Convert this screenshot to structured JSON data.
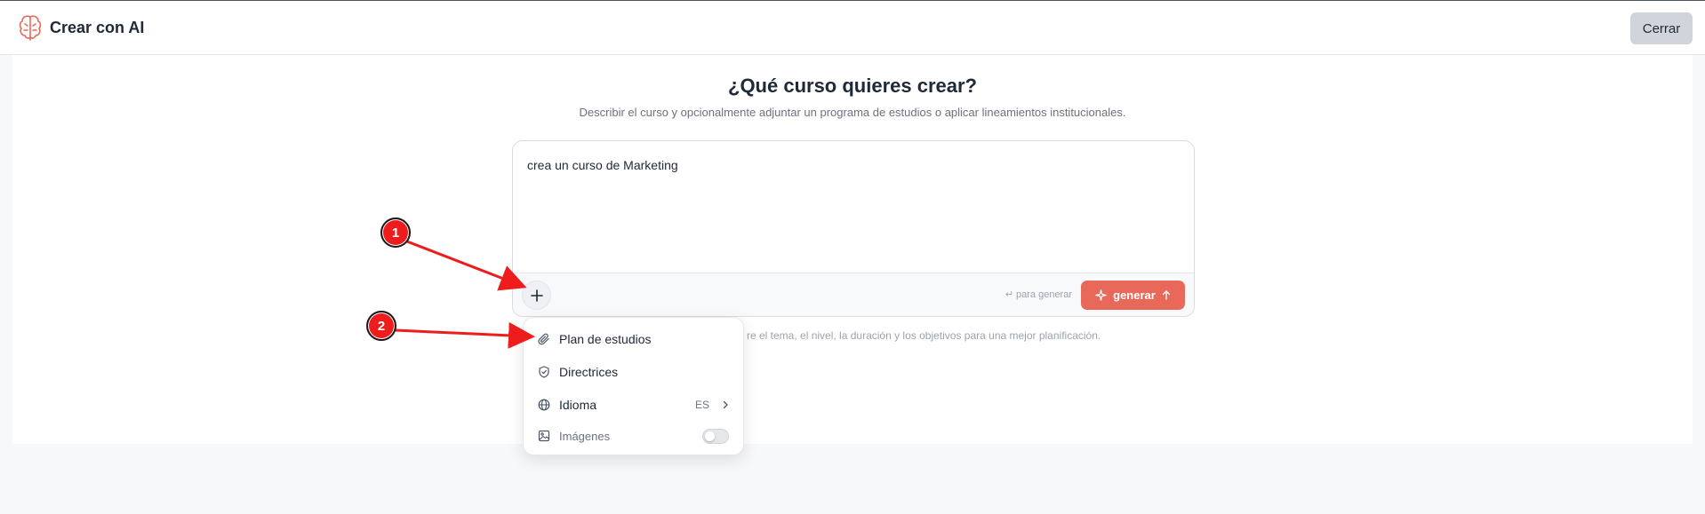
{
  "header": {
    "title": "Crear con AI",
    "close_label": "Cerrar"
  },
  "main": {
    "heading": "¿Qué curso quieres crear?",
    "subheading": "Describir el curso y opcionalmente adjuntar un programa de estudios o aplicar lineamientos institucionales.",
    "prompt_value": "crea un curso de Marketing",
    "hint": "↵ para generar",
    "generate_label": "generar",
    "tip_partial": "re el tema, el nivel, la duración y los objetivos para una mejor planificación."
  },
  "dropdown": {
    "items": [
      {
        "label": "Plan de estudios",
        "icon": "paperclip-icon"
      },
      {
        "label": "Directrices",
        "icon": "shield-check-icon"
      },
      {
        "label": "Idioma",
        "icon": "globe-icon",
        "value": "ES"
      },
      {
        "label": "Imágenes",
        "icon": "image-icon",
        "toggle": false
      }
    ]
  },
  "annotations": [
    {
      "number": "1"
    },
    {
      "number": "2"
    }
  ],
  "colors": {
    "accent": "#e8695a",
    "annotation_red": "#ee1c1c"
  }
}
